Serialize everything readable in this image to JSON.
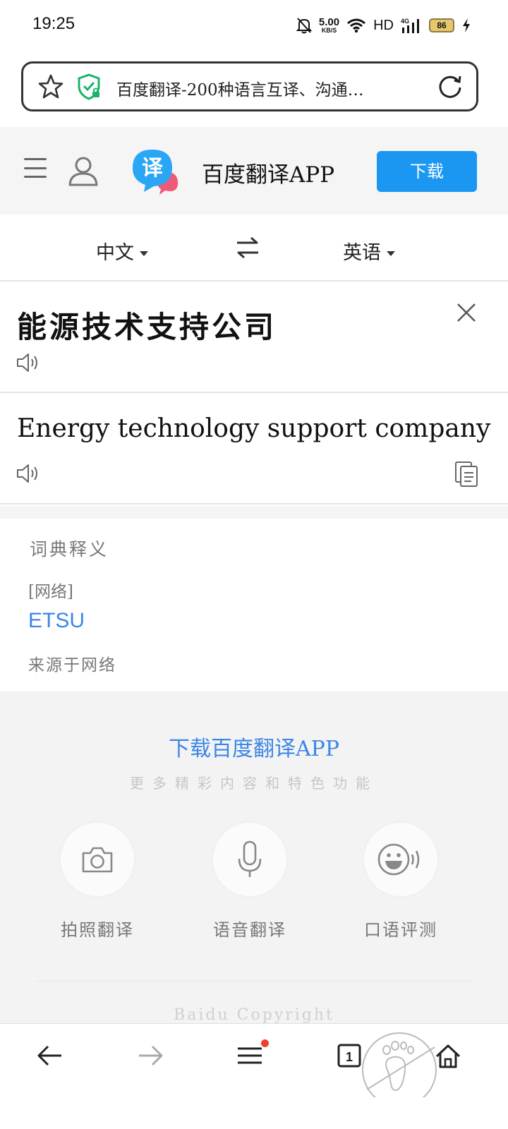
{
  "status_bar": {
    "time": "19:25",
    "net_speed_value": "5.00",
    "net_speed_unit": "KB/S",
    "hd_label": "HD",
    "signal_label": "4G",
    "battery_level": "86",
    "icons": [
      "bell-mute-icon",
      "wifi-icon",
      "signal-icon",
      "battery-icon",
      "charging-icon"
    ]
  },
  "address_bar": {
    "title": "百度翻译-200种语言互译、沟通…",
    "icons": [
      "star-icon",
      "secure-shield-icon",
      "reload-icon"
    ]
  },
  "header": {
    "app_name": "百度翻译APP",
    "download_label": "下载",
    "logo_glyph": "译",
    "colors": {
      "accent": "#1b97f2",
      "header_bg": "#f5f5f6"
    }
  },
  "languages": {
    "source": "中文",
    "target": "英语"
  },
  "source": {
    "text": "能源技术支持公司"
  },
  "result": {
    "text": "Energy technology support company"
  },
  "dictionary": {
    "title": "词典释义",
    "tag": "[网络]",
    "word": "ETSU",
    "source_note": "来源于网络",
    "word_color": "#3b86e6"
  },
  "promo": {
    "title": "下载百度翻译APP",
    "subtitle": "更多精彩内容和特色功能",
    "features": [
      {
        "label": "拍照翻译",
        "icon": "camera-icon"
      },
      {
        "label": "语音翻译",
        "icon": "microphone-icon"
      },
      {
        "label": "口语评测",
        "icon": "speaking-face-icon"
      }
    ],
    "copyright": "Baidu Copyright"
  },
  "toolbar": {
    "icons": [
      "back-arrow-icon",
      "forward-arrow-icon",
      "menu-icon",
      "tabs-icon",
      "home-icon"
    ],
    "tab_count": "1",
    "menu_badge_color": "#f0412f"
  }
}
